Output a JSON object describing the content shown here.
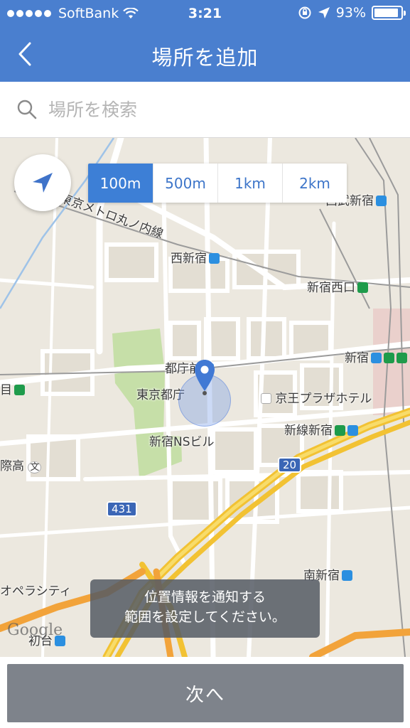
{
  "status_bar": {
    "carrier": "SoftBank",
    "time": "3:21",
    "battery_text": "93%",
    "battery_level": 0.93,
    "icons": [
      "signal-dots",
      "wifi-icon",
      "rotation-lock-icon",
      "location-arrow-icon",
      "battery-icon"
    ]
  },
  "nav": {
    "title": "場所を追加",
    "back_icon": "chevron-left-icon"
  },
  "search": {
    "placeholder": "場所を検索",
    "value": ""
  },
  "map": {
    "range_options": [
      "100m",
      "500m",
      "1km",
      "2km"
    ],
    "selected_range": "100m",
    "labels": {
      "nishishinjuku": "西新宿",
      "shinjuku_nishiguchi": "新宿西口",
      "shinjuku": "新宿",
      "tochomae": "都庁前",
      "tokyo_tocho": "東京都庁",
      "keio_plaza": "京王プラザホテル",
      "shinsen_shinjuku": "新線新宿",
      "shinjuku_ns": "新宿NSビル",
      "minami_shinjuku": "南新宿",
      "line_marunouchi": "東京メトロ丸ノ内線",
      "nishi_shinjuku_top": "西武新宿",
      "hatsudai": "初台",
      "operacity": "オペラシティ",
      "kousai": "際高",
      "left_edge": "目",
      "bun": "文"
    },
    "route_badges": [
      "431",
      "20"
    ],
    "google": "Google",
    "toast_line1": "位置情報を通知する",
    "toast_line2": "範囲を設定してください。"
  },
  "bottom": {
    "next_label": "次へ"
  },
  "colors": {
    "header": "#4a7fcf",
    "accent": "#3d7fd6",
    "next_button": "#7e838b"
  }
}
